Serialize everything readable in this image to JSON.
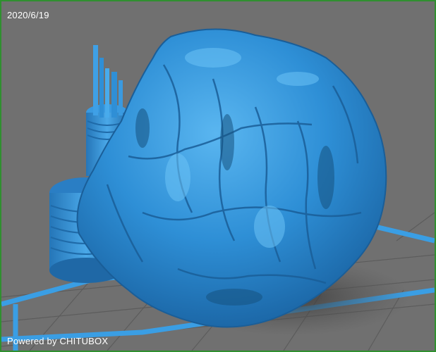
{
  "viewport": {
    "date": "2020/6/19",
    "watermark": "Powered by CHITUBOX"
  },
  "colors": {
    "background": "#707070",
    "frame": "#2f8f2f",
    "model": "#2e8fd6",
    "build_plate": "#3a9ee4",
    "grid_line": "#5a5a5a",
    "shadow": "#4a4a4a"
  },
  "model": {
    "name": "rock-with-tower-model"
  }
}
